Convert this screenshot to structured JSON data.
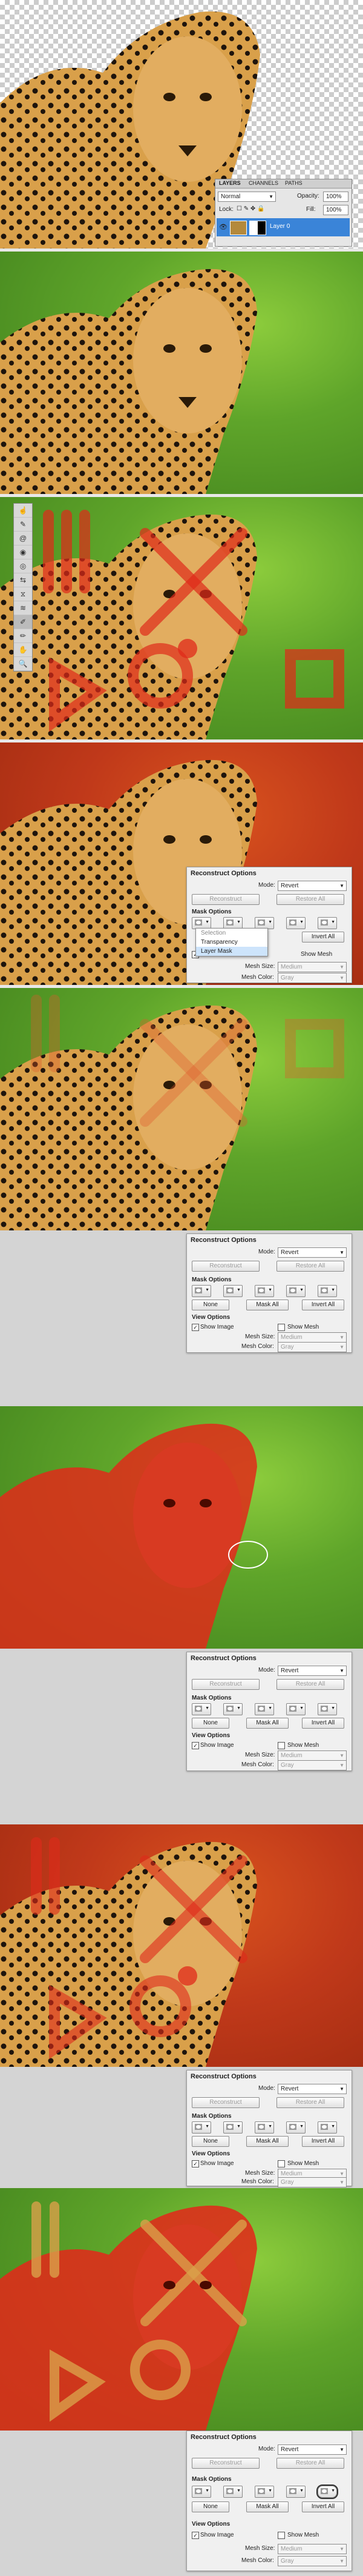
{
  "layers_panel": {
    "tabs": [
      "LAYERS",
      "CHANNELS",
      "PATHS"
    ],
    "blend_mode": "Normal",
    "opacity_label": "Opacity:",
    "opacity_value": "100%",
    "lock_label": "Lock:",
    "fill_label": "Fill:",
    "fill_value": "100%",
    "layer_name": "Layer 0"
  },
  "reconstruct": {
    "title": "Reconstruct Options",
    "mode_label": "Mode:",
    "mode_value": "Revert",
    "reconstruct_btn": "Reconstruct",
    "restore_all_btn": "Restore All"
  },
  "mask": {
    "title": "Mask Options",
    "none_btn": "None",
    "mask_all_btn": "Mask All",
    "invert_all_btn": "Invert All",
    "dropdown_items": [
      "Selection",
      "Transparency",
      "Layer Mask"
    ]
  },
  "view": {
    "title": "View Options",
    "show_image": "Show Image",
    "show_mesh": "Show Mesh",
    "mesh_size_label": "Mesh Size:",
    "mesh_size_value": "Medium",
    "mesh_color_label": "Mesh Color:",
    "mesh_color_value": "Gray"
  },
  "colors": {
    "mask_red": "#e02a1a",
    "grass_green": "#5fa52a",
    "layer_blue": "#3a84d8"
  }
}
